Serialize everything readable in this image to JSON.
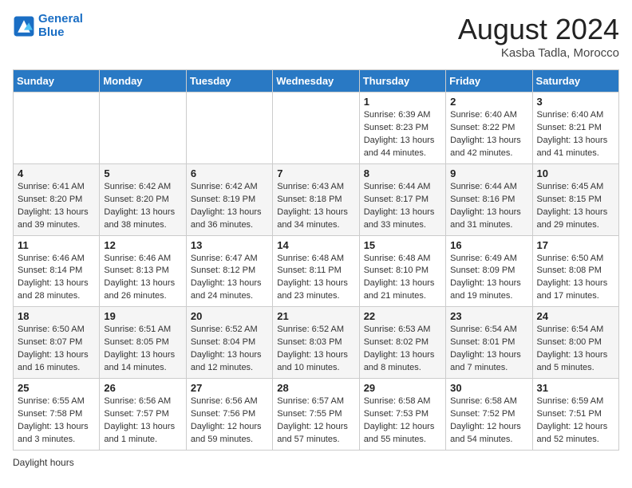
{
  "header": {
    "logo_line1": "General",
    "logo_line2": "Blue",
    "month_year": "August 2024",
    "location": "Kasba Tadla, Morocco"
  },
  "weekdays": [
    "Sunday",
    "Monday",
    "Tuesday",
    "Wednesday",
    "Thursday",
    "Friday",
    "Saturday"
  ],
  "weeks": [
    [
      {
        "day": "",
        "info": ""
      },
      {
        "day": "",
        "info": ""
      },
      {
        "day": "",
        "info": ""
      },
      {
        "day": "",
        "info": ""
      },
      {
        "day": "1",
        "info": "Sunrise: 6:39 AM\nSunset: 8:23 PM\nDaylight: 13 hours\nand 44 minutes."
      },
      {
        "day": "2",
        "info": "Sunrise: 6:40 AM\nSunset: 8:22 PM\nDaylight: 13 hours\nand 42 minutes."
      },
      {
        "day": "3",
        "info": "Sunrise: 6:40 AM\nSunset: 8:21 PM\nDaylight: 13 hours\nand 41 minutes."
      }
    ],
    [
      {
        "day": "4",
        "info": "Sunrise: 6:41 AM\nSunset: 8:20 PM\nDaylight: 13 hours\nand 39 minutes."
      },
      {
        "day": "5",
        "info": "Sunrise: 6:42 AM\nSunset: 8:20 PM\nDaylight: 13 hours\nand 38 minutes."
      },
      {
        "day": "6",
        "info": "Sunrise: 6:42 AM\nSunset: 8:19 PM\nDaylight: 13 hours\nand 36 minutes."
      },
      {
        "day": "7",
        "info": "Sunrise: 6:43 AM\nSunset: 8:18 PM\nDaylight: 13 hours\nand 34 minutes."
      },
      {
        "day": "8",
        "info": "Sunrise: 6:44 AM\nSunset: 8:17 PM\nDaylight: 13 hours\nand 33 minutes."
      },
      {
        "day": "9",
        "info": "Sunrise: 6:44 AM\nSunset: 8:16 PM\nDaylight: 13 hours\nand 31 minutes."
      },
      {
        "day": "10",
        "info": "Sunrise: 6:45 AM\nSunset: 8:15 PM\nDaylight: 13 hours\nand 29 minutes."
      }
    ],
    [
      {
        "day": "11",
        "info": "Sunrise: 6:46 AM\nSunset: 8:14 PM\nDaylight: 13 hours\nand 28 minutes."
      },
      {
        "day": "12",
        "info": "Sunrise: 6:46 AM\nSunset: 8:13 PM\nDaylight: 13 hours\nand 26 minutes."
      },
      {
        "day": "13",
        "info": "Sunrise: 6:47 AM\nSunset: 8:12 PM\nDaylight: 13 hours\nand 24 minutes."
      },
      {
        "day": "14",
        "info": "Sunrise: 6:48 AM\nSunset: 8:11 PM\nDaylight: 13 hours\nand 23 minutes."
      },
      {
        "day": "15",
        "info": "Sunrise: 6:48 AM\nSunset: 8:10 PM\nDaylight: 13 hours\nand 21 minutes."
      },
      {
        "day": "16",
        "info": "Sunrise: 6:49 AM\nSunset: 8:09 PM\nDaylight: 13 hours\nand 19 minutes."
      },
      {
        "day": "17",
        "info": "Sunrise: 6:50 AM\nSunset: 8:08 PM\nDaylight: 13 hours\nand 17 minutes."
      }
    ],
    [
      {
        "day": "18",
        "info": "Sunrise: 6:50 AM\nSunset: 8:07 PM\nDaylight: 13 hours\nand 16 minutes."
      },
      {
        "day": "19",
        "info": "Sunrise: 6:51 AM\nSunset: 8:05 PM\nDaylight: 13 hours\nand 14 minutes."
      },
      {
        "day": "20",
        "info": "Sunrise: 6:52 AM\nSunset: 8:04 PM\nDaylight: 13 hours\nand 12 minutes."
      },
      {
        "day": "21",
        "info": "Sunrise: 6:52 AM\nSunset: 8:03 PM\nDaylight: 13 hours\nand 10 minutes."
      },
      {
        "day": "22",
        "info": "Sunrise: 6:53 AM\nSunset: 8:02 PM\nDaylight: 13 hours\nand 8 minutes."
      },
      {
        "day": "23",
        "info": "Sunrise: 6:54 AM\nSunset: 8:01 PM\nDaylight: 13 hours\nand 7 minutes."
      },
      {
        "day": "24",
        "info": "Sunrise: 6:54 AM\nSunset: 8:00 PM\nDaylight: 13 hours\nand 5 minutes."
      }
    ],
    [
      {
        "day": "25",
        "info": "Sunrise: 6:55 AM\nSunset: 7:58 PM\nDaylight: 13 hours\nand 3 minutes."
      },
      {
        "day": "26",
        "info": "Sunrise: 6:56 AM\nSunset: 7:57 PM\nDaylight: 13 hours\nand 1 minute."
      },
      {
        "day": "27",
        "info": "Sunrise: 6:56 AM\nSunset: 7:56 PM\nDaylight: 12 hours\nand 59 minutes."
      },
      {
        "day": "28",
        "info": "Sunrise: 6:57 AM\nSunset: 7:55 PM\nDaylight: 12 hours\nand 57 minutes."
      },
      {
        "day": "29",
        "info": "Sunrise: 6:58 AM\nSunset: 7:53 PM\nDaylight: 12 hours\nand 55 minutes."
      },
      {
        "day": "30",
        "info": "Sunrise: 6:58 AM\nSunset: 7:52 PM\nDaylight: 12 hours\nand 54 minutes."
      },
      {
        "day": "31",
        "info": "Sunrise: 6:59 AM\nSunset: 7:51 PM\nDaylight: 12 hours\nand 52 minutes."
      }
    ]
  ],
  "footer": {
    "note": "Daylight hours"
  }
}
